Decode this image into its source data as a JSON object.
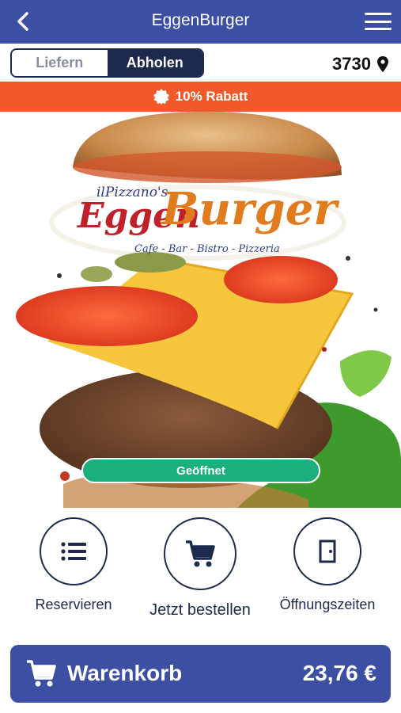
{
  "header": {
    "title": "EggenBurger",
    "back_icon": "chevron-left-icon",
    "menu_icon": "hamburger-menu-icon"
  },
  "mode": {
    "options": [
      "Liefern",
      "Abholen"
    ],
    "selected": "Abholen"
  },
  "location": {
    "zip": "3730",
    "icon": "map-pin-icon"
  },
  "promo": {
    "text": "10% Rabatt",
    "icon": "badge-icon",
    "color": "#f1582a"
  },
  "hero": {
    "logo_small": "ilPizzano's",
    "logo_main_1": "Eggen",
    "logo_main_2": "Burger",
    "logo_sub": "Cafe - Bar - Bistro - Pizzeria",
    "status": "Geöffnet"
  },
  "actions": [
    {
      "label": "Reservieren",
      "icon": "list-icon"
    },
    {
      "label": "Jetzt bestellen",
      "icon": "cart-icon"
    },
    {
      "label": "Öffnungszeiten",
      "icon": "door-icon"
    }
  ],
  "cart": {
    "label": "Warenkorb",
    "total": "23,76 €",
    "icon": "cart-icon"
  },
  "colors": {
    "primary": "#3d4fa3",
    "dark": "#1d2a4d",
    "accent": "#f1582a",
    "open": "#1bb07e"
  }
}
